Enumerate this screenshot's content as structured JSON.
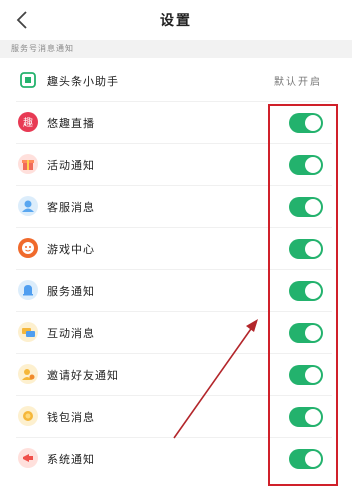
{
  "header": {
    "title": "设置"
  },
  "section": {
    "title": "服务号消息通知"
  },
  "assistant": {
    "label": "趣头条小助手",
    "status": "默认开启"
  },
  "items": [
    {
      "label": "悠趣直播",
      "on": true,
      "icon": "live-icon",
      "color": "#e83a54"
    },
    {
      "label": "活动通知",
      "on": true,
      "icon": "gift-icon",
      "color": "#ffd9d6"
    },
    {
      "label": "客服消息",
      "on": true,
      "icon": "customer-service-icon",
      "color": "#d7ecfb"
    },
    {
      "label": "游戏中心",
      "on": true,
      "icon": "game-icon",
      "color": "#f06a2c"
    },
    {
      "label": "服务通知",
      "on": true,
      "icon": "bell-icon",
      "color": "#d7ecfb"
    },
    {
      "label": "互动消息",
      "on": true,
      "icon": "interaction-icon",
      "color": "#fdf0cf"
    },
    {
      "label": "邀请好友通知",
      "on": true,
      "icon": "invite-icon",
      "color": "#fdf0cf"
    },
    {
      "label": "钱包消息",
      "on": true,
      "icon": "wallet-icon",
      "color": "#fdf0cf"
    },
    {
      "label": "系统通知",
      "on": true,
      "icon": "megaphone-icon",
      "color": "#ffd9d6"
    }
  ],
  "colors": {
    "toggle_on": "#23b26d",
    "highlight": "#d0202a"
  }
}
